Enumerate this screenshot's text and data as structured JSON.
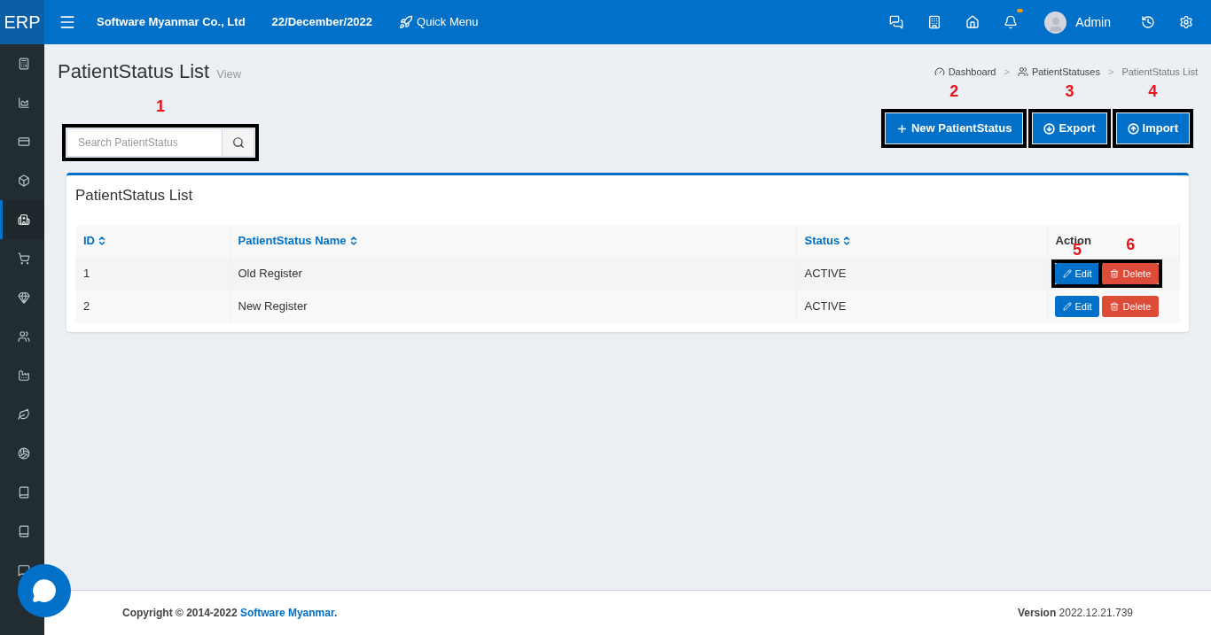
{
  "topbar": {
    "logo": "ERP",
    "company": "Software Myanmar Co., Ltd",
    "date": "22/December/2022",
    "quick_menu": "Quick Menu",
    "user": "Admin",
    "notification_dot": true
  },
  "sidebar": {
    "items": [
      {
        "selected": false
      },
      {
        "selected": false
      },
      {
        "selected": false
      },
      {
        "selected": false
      },
      {
        "selected": true
      },
      {
        "selected": false
      },
      {
        "selected": false
      },
      {
        "selected": false
      },
      {
        "selected": false
      },
      {
        "selected": false
      },
      {
        "selected": false
      },
      {
        "selected": false
      },
      {
        "selected": false
      },
      {
        "selected": false
      }
    ]
  },
  "page": {
    "title": "PatientStatus List",
    "subtitle": "View"
  },
  "breadcrumb": [
    {
      "label": "Dashboard",
      "separator": ">"
    },
    {
      "label": "PatientStatuses",
      "separator": ">"
    },
    {
      "label": "PatientStatus List"
    }
  ],
  "search": {
    "placeholder": "Search PatientStatus",
    "marker": "1"
  },
  "buttons": [
    {
      "kind": "new",
      "label": "New PatientStatus",
      "marker": "2"
    },
    {
      "kind": "export",
      "label": "Export",
      "marker": "3"
    },
    {
      "kind": "import",
      "label": "Import",
      "marker": "4"
    }
  ],
  "card": {
    "title": "PatientStatus List"
  },
  "table": {
    "columns": [
      {
        "label": "ID",
        "sortable": true
      },
      {
        "label": "PatientStatus Name",
        "sortable": true
      },
      {
        "label": "Status",
        "sortable": true
      },
      {
        "label": "Action",
        "sortable": false
      }
    ],
    "rows": [
      {
        "cells": [
          "1",
          "Old Register",
          "ACTIVE"
        ],
        "edit": "Edit",
        "delete": "Delete",
        "edit_marker": "5",
        "delete_marker": "6"
      },
      {
        "cells": [
          "2",
          "New Register",
          "ACTIVE"
        ],
        "edit": "Edit",
        "delete": "Delete"
      }
    ]
  },
  "footer": {
    "copyright": "Copyright © 2014-2022 ",
    "company": "Software Myanmar",
    "period": ".",
    "version_label": "Version",
    "version": "2022.12.21.739"
  }
}
